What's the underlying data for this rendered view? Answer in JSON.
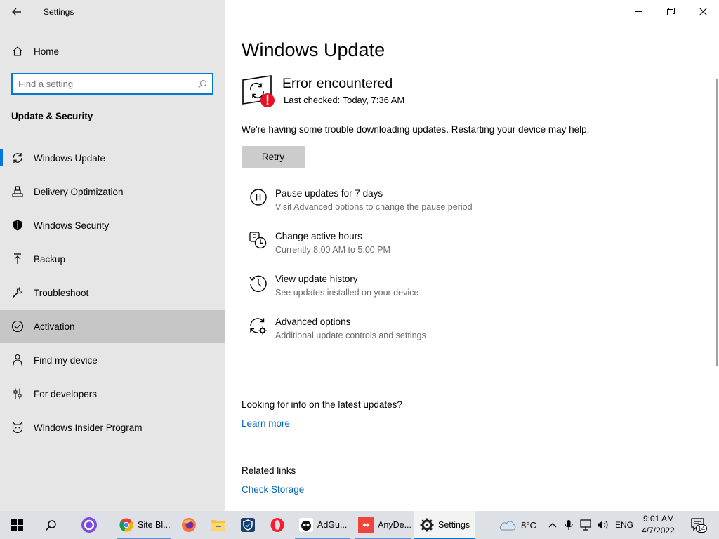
{
  "window": {
    "title": "Settings"
  },
  "sidebar": {
    "home_label": "Home",
    "search_placeholder": "Find a setting",
    "section_title": "Update & Security",
    "items": [
      {
        "label": "Windows Update",
        "icon": "sync-icon"
      },
      {
        "label": "Delivery Optimization",
        "icon": "delivery-optimization-icon"
      },
      {
        "label": "Windows Security",
        "icon": "shield-icon"
      },
      {
        "label": "Backup",
        "icon": "backup-arrow-icon"
      },
      {
        "label": "Troubleshoot",
        "icon": "wrench-icon"
      },
      {
        "label": "Activation",
        "icon": "check-circle-icon"
      },
      {
        "label": "Find my device",
        "icon": "person-location-icon"
      },
      {
        "label": "For developers",
        "icon": "developer-sliders-icon"
      },
      {
        "label": "Windows Insider Program",
        "icon": "insider-cat-icon"
      }
    ],
    "selected_index": 0,
    "hover_index": 5
  },
  "main": {
    "title": "Windows Update",
    "status": {
      "title": "Error encountered",
      "last_checked": "Last checked: Today, 7:36 AM"
    },
    "message": "We're having some trouble downloading updates. Restarting your device may help.",
    "retry_label": "Retry",
    "options": [
      {
        "title": "Pause updates for 7 days",
        "subtitle": "Visit Advanced options to change the pause period",
        "icon": "pause-circle-icon"
      },
      {
        "title": "Change active hours",
        "subtitle": "Currently 8:00 AM to 5:00 PM",
        "icon": "active-hours-clock-icon"
      },
      {
        "title": "View update history",
        "subtitle": "See updates installed on your device",
        "icon": "history-icon"
      },
      {
        "title": "Advanced options",
        "subtitle": "Additional update controls and settings",
        "icon": "advanced-sync-gear-icon"
      }
    ],
    "info": {
      "question": "Looking for info on the latest updates?",
      "learn_more": "Learn more"
    },
    "related": {
      "title": "Related links",
      "check_storage": "Check Storage"
    }
  },
  "taskbar": {
    "apps": [
      {
        "label": "Site Bl...",
        "icon": "chrome-icon"
      },
      {
        "label": "",
        "icon": "firefox-icon"
      },
      {
        "label": "",
        "icon": "file-explorer-icon"
      },
      {
        "label": "",
        "icon": "shield-app-icon"
      },
      {
        "label": "",
        "icon": "opera-icon"
      },
      {
        "label": "AdGu...",
        "icon": "adguard-icon"
      },
      {
        "label": "AnyDe...",
        "icon": "anydesk-icon"
      },
      {
        "label": "Settings",
        "icon": "settings-gear-icon"
      }
    ],
    "weather": {
      "temp": "8°C",
      "icon": "cloud-icon"
    },
    "language": "ENG",
    "clock": {
      "time": "9:01 AM",
      "date": "4/7/2022"
    },
    "notifications_count": "14"
  },
  "colors": {
    "accent": "#0078d7",
    "sidebar_bg": "#e6e6e6",
    "hover_bg": "#c6c6c6",
    "link": "#0067c0",
    "error": "#e81123",
    "taskbar_bg": "#dde1e6"
  }
}
